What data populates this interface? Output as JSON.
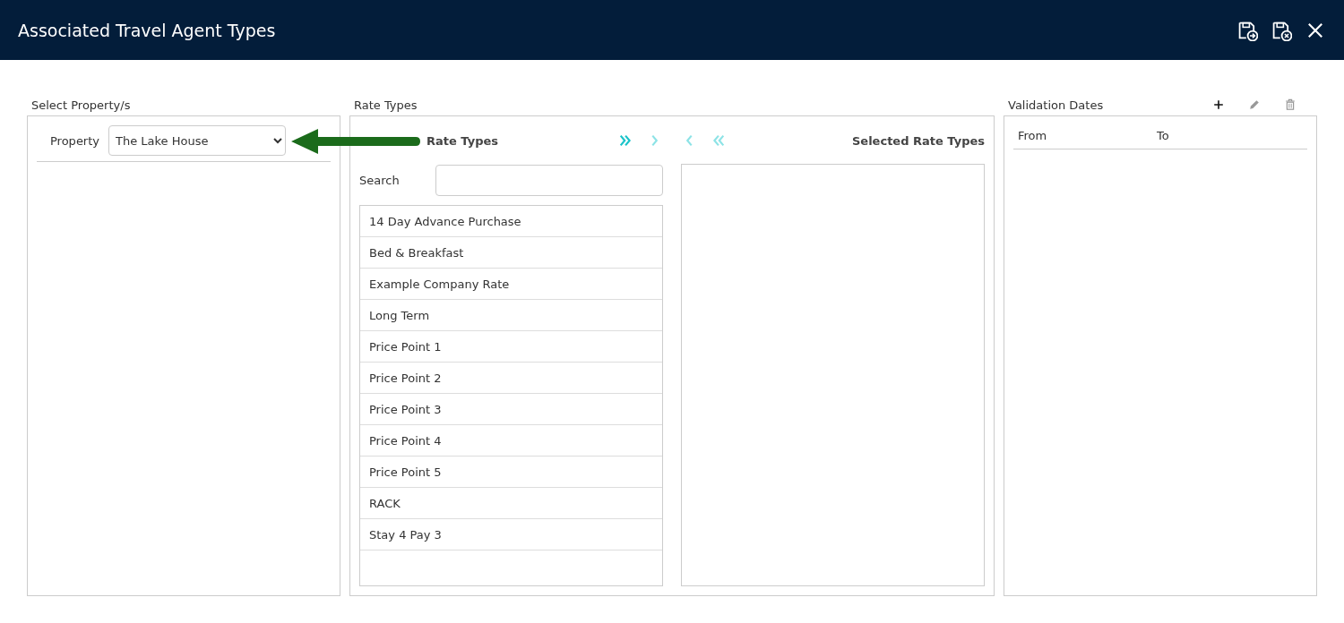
{
  "window": {
    "title": "Associated Travel Agent Types"
  },
  "header_actions": [
    {
      "kind": "save-go"
    },
    {
      "kind": "save-close"
    },
    {
      "kind": "close"
    }
  ],
  "property_section": {
    "title": "Select Property/s",
    "field_label": "Property",
    "value": "The Lake House"
  },
  "rate_types": {
    "title": "Rate Types",
    "available_heading": "Rate Types",
    "selected_heading": "Selected Rate Types",
    "transfer_buttons": [
      {
        "kind": "all-right",
        "disabled": false
      },
      {
        "kind": "right",
        "disabled": true
      },
      {
        "kind": "left",
        "disabled": true
      },
      {
        "kind": "all-left",
        "disabled": true
      }
    ],
    "search_label": "Search",
    "available": [
      {
        "name": "14 Day Advance Purchase"
      },
      {
        "name": "Bed & Breakfast"
      },
      {
        "name": "Example Company Rate"
      },
      {
        "name": "Long Term"
      },
      {
        "name": "Price Point 1"
      },
      {
        "name": "Price Point 2"
      },
      {
        "name": "Price Point 3"
      },
      {
        "name": "Price Point 4"
      },
      {
        "name": "Price Point 5"
      },
      {
        "name": "RACK"
      },
      {
        "name": "Stay 4 Pay 3"
      }
    ]
  },
  "validation_dates": {
    "title": "Validation Dates",
    "actions": [
      {
        "kind": "add",
        "disabled": false
      },
      {
        "kind": "edit",
        "disabled": true
      },
      {
        "kind": "delete",
        "disabled": true
      }
    ],
    "columns": [
      "From",
      "To"
    ]
  }
}
